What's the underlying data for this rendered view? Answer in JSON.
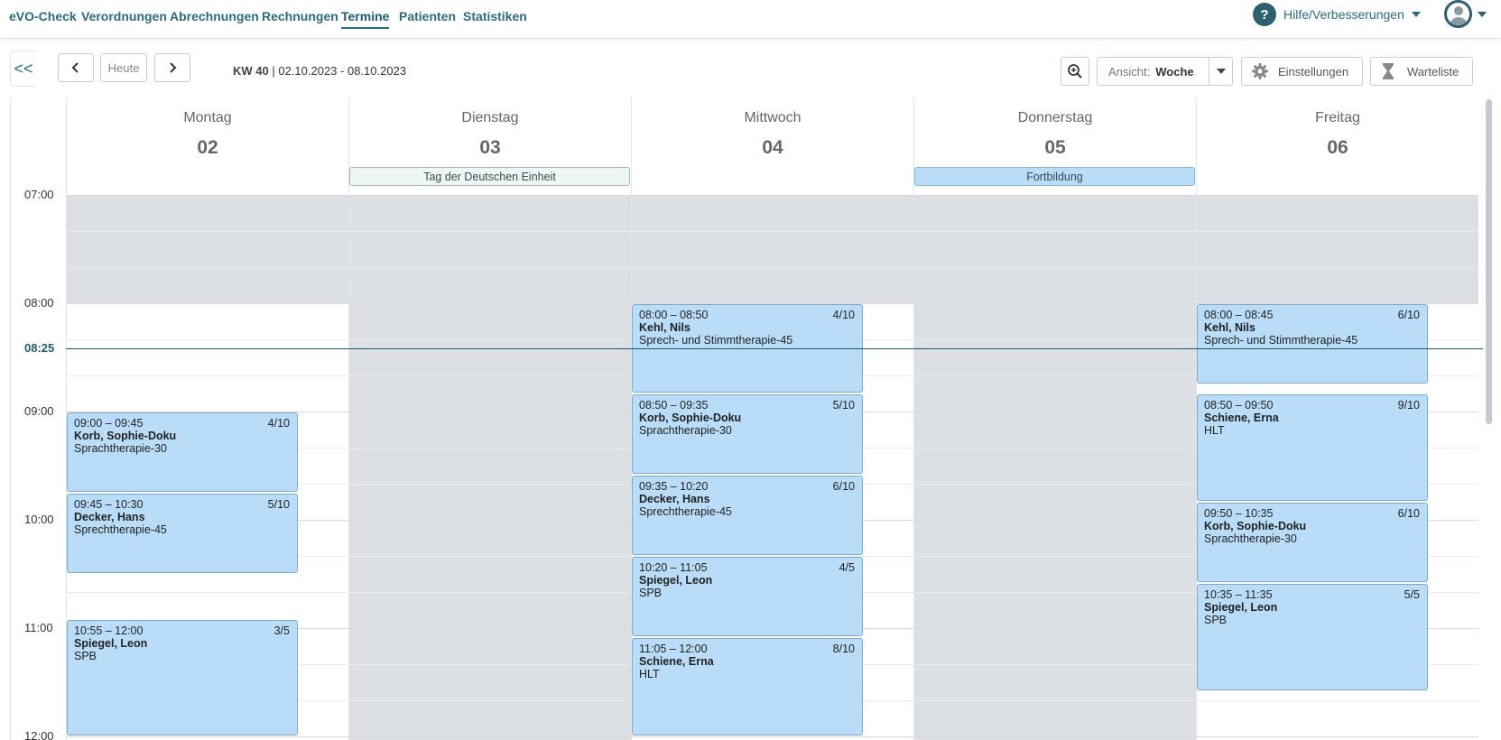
{
  "nav": {
    "items": [
      {
        "label": "eVO-Check",
        "active": false
      },
      {
        "label": "Verordnungen",
        "active": false
      },
      {
        "label": "Abrechnungen",
        "active": false
      },
      {
        "label": "Rechnungen",
        "active": false
      },
      {
        "label": "Termine",
        "active": true
      },
      {
        "label": "Patienten",
        "active": false
      },
      {
        "label": "Statistiken",
        "active": false
      }
    ],
    "help_label": "Hilfe/Verbesserungen",
    "help_icon_text": "?"
  },
  "toolbar": {
    "collapse_label": "<<",
    "today_label": "Heute",
    "week_number": "KW 40",
    "date_range": "| 02.10.2023 - 08.10.2023",
    "view_prefix": "Ansicht:",
    "view_value": "Woche",
    "settings_label": "Einstellungen",
    "waitlist_label": "Warteliste"
  },
  "days": [
    {
      "name": "Montag",
      "number": "02"
    },
    {
      "name": "Dienstag",
      "number": "03"
    },
    {
      "name": "Mittwoch",
      "number": "04"
    },
    {
      "name": "Donnerstag",
      "number": "05"
    },
    {
      "name": "Freitag",
      "number": "06"
    }
  ],
  "all_day_events": [
    {
      "day": 1,
      "label": "Tag der Deutschen Einheit",
      "kind": "holiday"
    },
    {
      "day": 3,
      "label": "Fortbildung",
      "kind": "training"
    }
  ],
  "hours": [
    "07:00",
    "08:00",
    "09:00",
    "10:00",
    "11:00",
    "12:00"
  ],
  "current_time": "08:25",
  "appointments": [
    {
      "day": 0,
      "time": "09:00 – 09:45",
      "count": "4/10",
      "patient": "Korb, Sophie-Doku",
      "therapy": "Sprachtherapie-30"
    },
    {
      "day": 0,
      "time": "09:45 – 10:30",
      "count": "5/10",
      "patient": "Decker, Hans",
      "therapy": "Sprechtherapie-45"
    },
    {
      "day": 0,
      "time": "10:55 – 12:00",
      "count": "3/5",
      "patient": "Spiegel, Leon",
      "therapy": "SPB"
    },
    {
      "day": 2,
      "time": "08:00 – 08:50",
      "count": "4/10",
      "patient": "Kehl, Nils",
      "therapy": "Sprech- und Stimmtherapie-45"
    },
    {
      "day": 2,
      "time": "08:50 – 09:35",
      "count": "5/10",
      "patient": "Korb, Sophie-Doku",
      "therapy": "Sprachtherapie-30"
    },
    {
      "day": 2,
      "time": "09:35 – 10:20",
      "count": "6/10",
      "patient": "Decker, Hans",
      "therapy": "Sprechtherapie-45"
    },
    {
      "day": 2,
      "time": "10:20 – 11:05",
      "count": "4/5",
      "patient": "Spiegel, Leon",
      "therapy": "SPB"
    },
    {
      "day": 2,
      "time": "11:05 – 12:00",
      "count": "8/10",
      "patient": "Schiene, Erna",
      "therapy": "HLT"
    },
    {
      "day": 4,
      "time": "08:00 – 08:45",
      "count": "6/10",
      "patient": "Kehl, Nils",
      "therapy": "Sprech- und Stimmtherapie-45"
    },
    {
      "day": 4,
      "time": "08:50 – 09:50",
      "count": "9/10",
      "patient": "Schiene, Erna",
      "therapy": "HLT"
    },
    {
      "day": 4,
      "time": "09:50 – 10:35",
      "count": "6/10",
      "patient": "Korb, Sophie-Doku",
      "therapy": "Sprachtherapie-30"
    },
    {
      "day": 4,
      "time": "10:35 – 11:35",
      "count": "5/5",
      "patient": "Spiegel, Leon",
      "therapy": "SPB"
    }
  ],
  "colors": {
    "accent": "#2d6a7e",
    "appointment_bg": "#b9ddf8",
    "unavailable_bg": "#dcdfe3"
  }
}
